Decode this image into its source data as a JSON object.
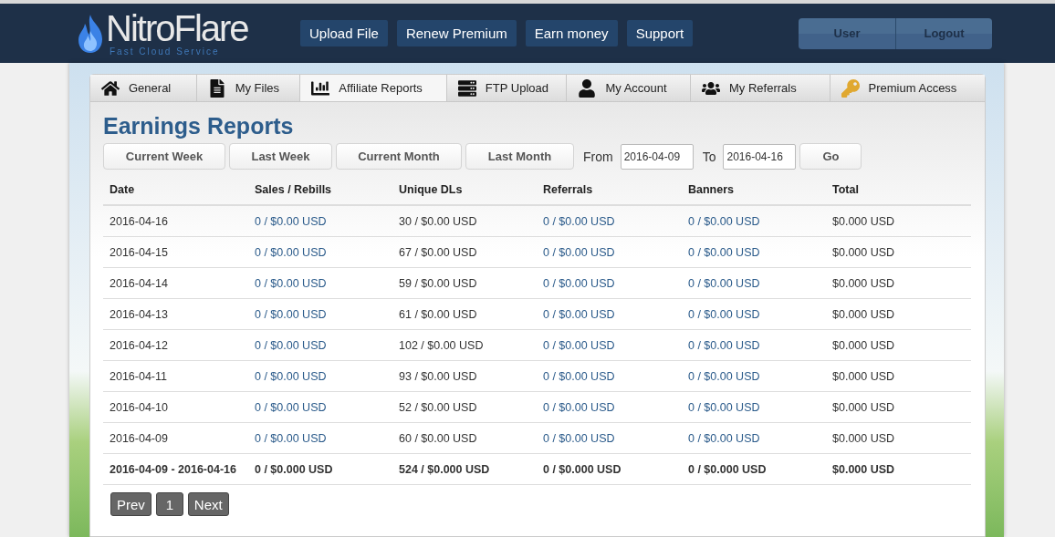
{
  "logo": {
    "name": "NitroFlare",
    "tagline": "Fast Cloud Service"
  },
  "nav": [
    "Upload File",
    "Renew Premium",
    "Earn money",
    "Support"
  ],
  "account": [
    "User",
    "Logout"
  ],
  "tabs": [
    {
      "label": "General",
      "selected": false
    },
    {
      "label": "My Files",
      "selected": false
    },
    {
      "label": "Affiliate Reports",
      "selected": true
    },
    {
      "label": "FTP Upload",
      "selected": false
    },
    {
      "label": "My Account",
      "selected": false
    },
    {
      "label": "My Referrals",
      "selected": false
    },
    {
      "label": "Premium Access",
      "selected": false
    }
  ],
  "title": "Earnings Reports",
  "filters": [
    "Current Week",
    "Last Week",
    "Current Month",
    "Last Month"
  ],
  "range": {
    "from_label": "From",
    "from": "2016-04-09",
    "to_label": "To",
    "to": "2016-04-16",
    "go": "Go"
  },
  "table": {
    "columns": [
      {
        "label": "Date",
        "kind": "text"
      },
      {
        "label": "Sales / Rebills",
        "kind": "link"
      },
      {
        "label": "Unique DLs",
        "kind": "text"
      },
      {
        "label": "Referrals",
        "kind": "link"
      },
      {
        "label": "Banners",
        "kind": "link"
      },
      {
        "label": "Total",
        "kind": "text"
      }
    ],
    "rows": [
      {
        "kind": "day",
        "cells": [
          "2016-04-16",
          "0 / $0.00 USD",
          "30 / $0.00 USD",
          "0 / $0.00 USD",
          "0 / $0.00 USD",
          "$0.000 USD"
        ]
      },
      {
        "kind": "day",
        "cells": [
          "2016-04-15",
          "0 / $0.00 USD",
          "67 / $0.00 USD",
          "0 / $0.00 USD",
          "0 / $0.00 USD",
          "$0.000 USD"
        ]
      },
      {
        "kind": "day",
        "cells": [
          "2016-04-14",
          "0 / $0.00 USD",
          "59 / $0.00 USD",
          "0 / $0.00 USD",
          "0 / $0.00 USD",
          "$0.000 USD"
        ]
      },
      {
        "kind": "day",
        "cells": [
          "2016-04-13",
          "0 / $0.00 USD",
          "61 / $0.00 USD",
          "0 / $0.00 USD",
          "0 / $0.00 USD",
          "$0.000 USD"
        ]
      },
      {
        "kind": "day",
        "cells": [
          "2016-04-12",
          "0 / $0.00 USD",
          "102 / $0.00 USD",
          "0 / $0.00 USD",
          "0 / $0.00 USD",
          "$0.000 USD"
        ]
      },
      {
        "kind": "day",
        "cells": [
          "2016-04-11",
          "0 / $0.00 USD",
          "93 / $0.00 USD",
          "0 / $0.00 USD",
          "0 / $0.00 USD",
          "$0.000 USD"
        ]
      },
      {
        "kind": "day",
        "cells": [
          "2016-04-10",
          "0 / $0.00 USD",
          "52 / $0.00 USD",
          "0 / $0.00 USD",
          "0 / $0.00 USD",
          "$0.000 USD"
        ]
      },
      {
        "kind": "day",
        "cells": [
          "2016-04-09",
          "0 / $0.00 USD",
          "60 / $0.00 USD",
          "0 / $0.00 USD",
          "0 / $0.00 USD",
          "$0.000 USD"
        ]
      },
      {
        "kind": "total",
        "cells": [
          "2016-04-09 - 2016-04-16",
          "0 / $0.000 USD",
          "524 / $0.000 USD",
          "0 / $0.000 USD",
          "0 / $0.000 USD",
          "$0.000 USD"
        ]
      }
    ]
  },
  "pagination": [
    "Prev",
    "1",
    "Next"
  ]
}
